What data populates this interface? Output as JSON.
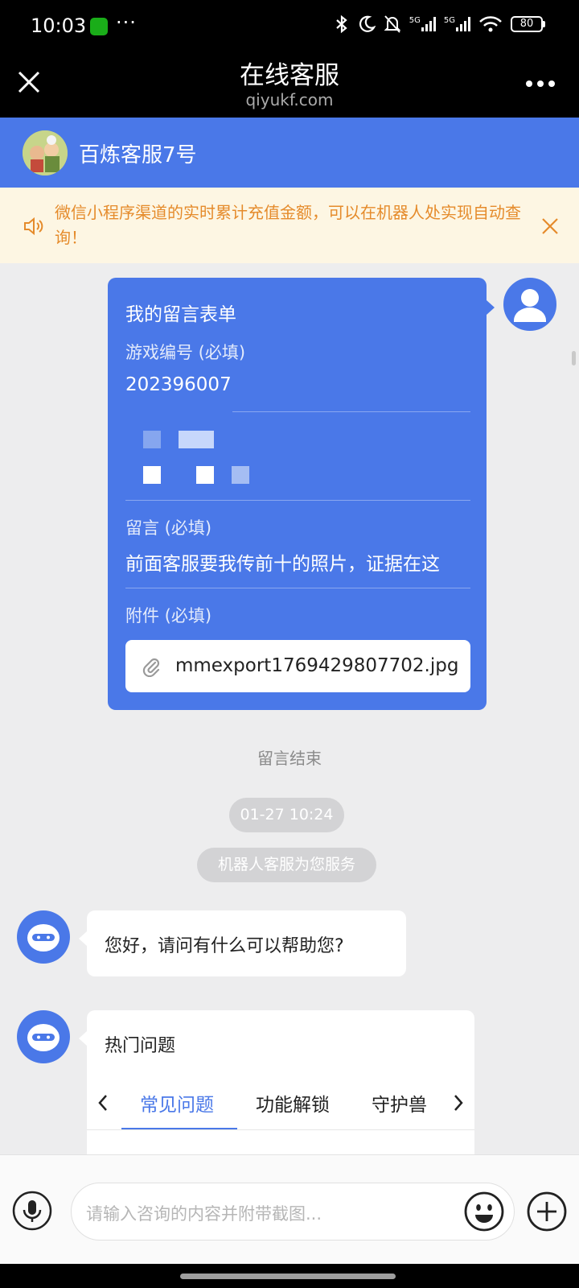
{
  "status_bar": {
    "time": "10:03",
    "dots": "···",
    "net1": "5G",
    "net2": "5G",
    "battery": "80"
  },
  "header": {
    "title": "在线客服",
    "subtitle": "qiyukf.com"
  },
  "agent": {
    "name": "百炼客服7号"
  },
  "notice": {
    "text": "微信小程序渠道的实时累计充值金额，可以在机器人处实现自动查询！"
  },
  "form": {
    "title": "我的留言表单",
    "game_id_label": "游戏编号 (必填)",
    "game_id_value": "202396007",
    "message_label": "留言 (必填)",
    "message_value": "前面客服要我传前十的照片，证据在这",
    "attachment_label": "附件 (必填)",
    "attachment_name": "mmexport1769429807702.jpg"
  },
  "chat": {
    "form_end": "留言结束",
    "timestamp": "01-27 10:24",
    "robot_notice": "机器人客服为您服务",
    "greeting": "您好，请问有什么可以帮助您?",
    "hot_title": "热门问题",
    "hot_tabs": [
      "常见问题",
      "功能解锁",
      "守护兽"
    ],
    "active_tab": 0
  },
  "input": {
    "placeholder": "请输入咨询的内容并附带截图..."
  },
  "colors": {
    "brand": "#4a78e8",
    "notice_text": "#e58b2b",
    "notice_bg": "#fdf6e3"
  },
  "icons": [
    "close-icon",
    "more-icon",
    "speaker-icon",
    "paperclip-icon",
    "microphone-icon",
    "emoji-icon",
    "plus-icon",
    "chevron-left-icon",
    "chevron-right-icon"
  ]
}
